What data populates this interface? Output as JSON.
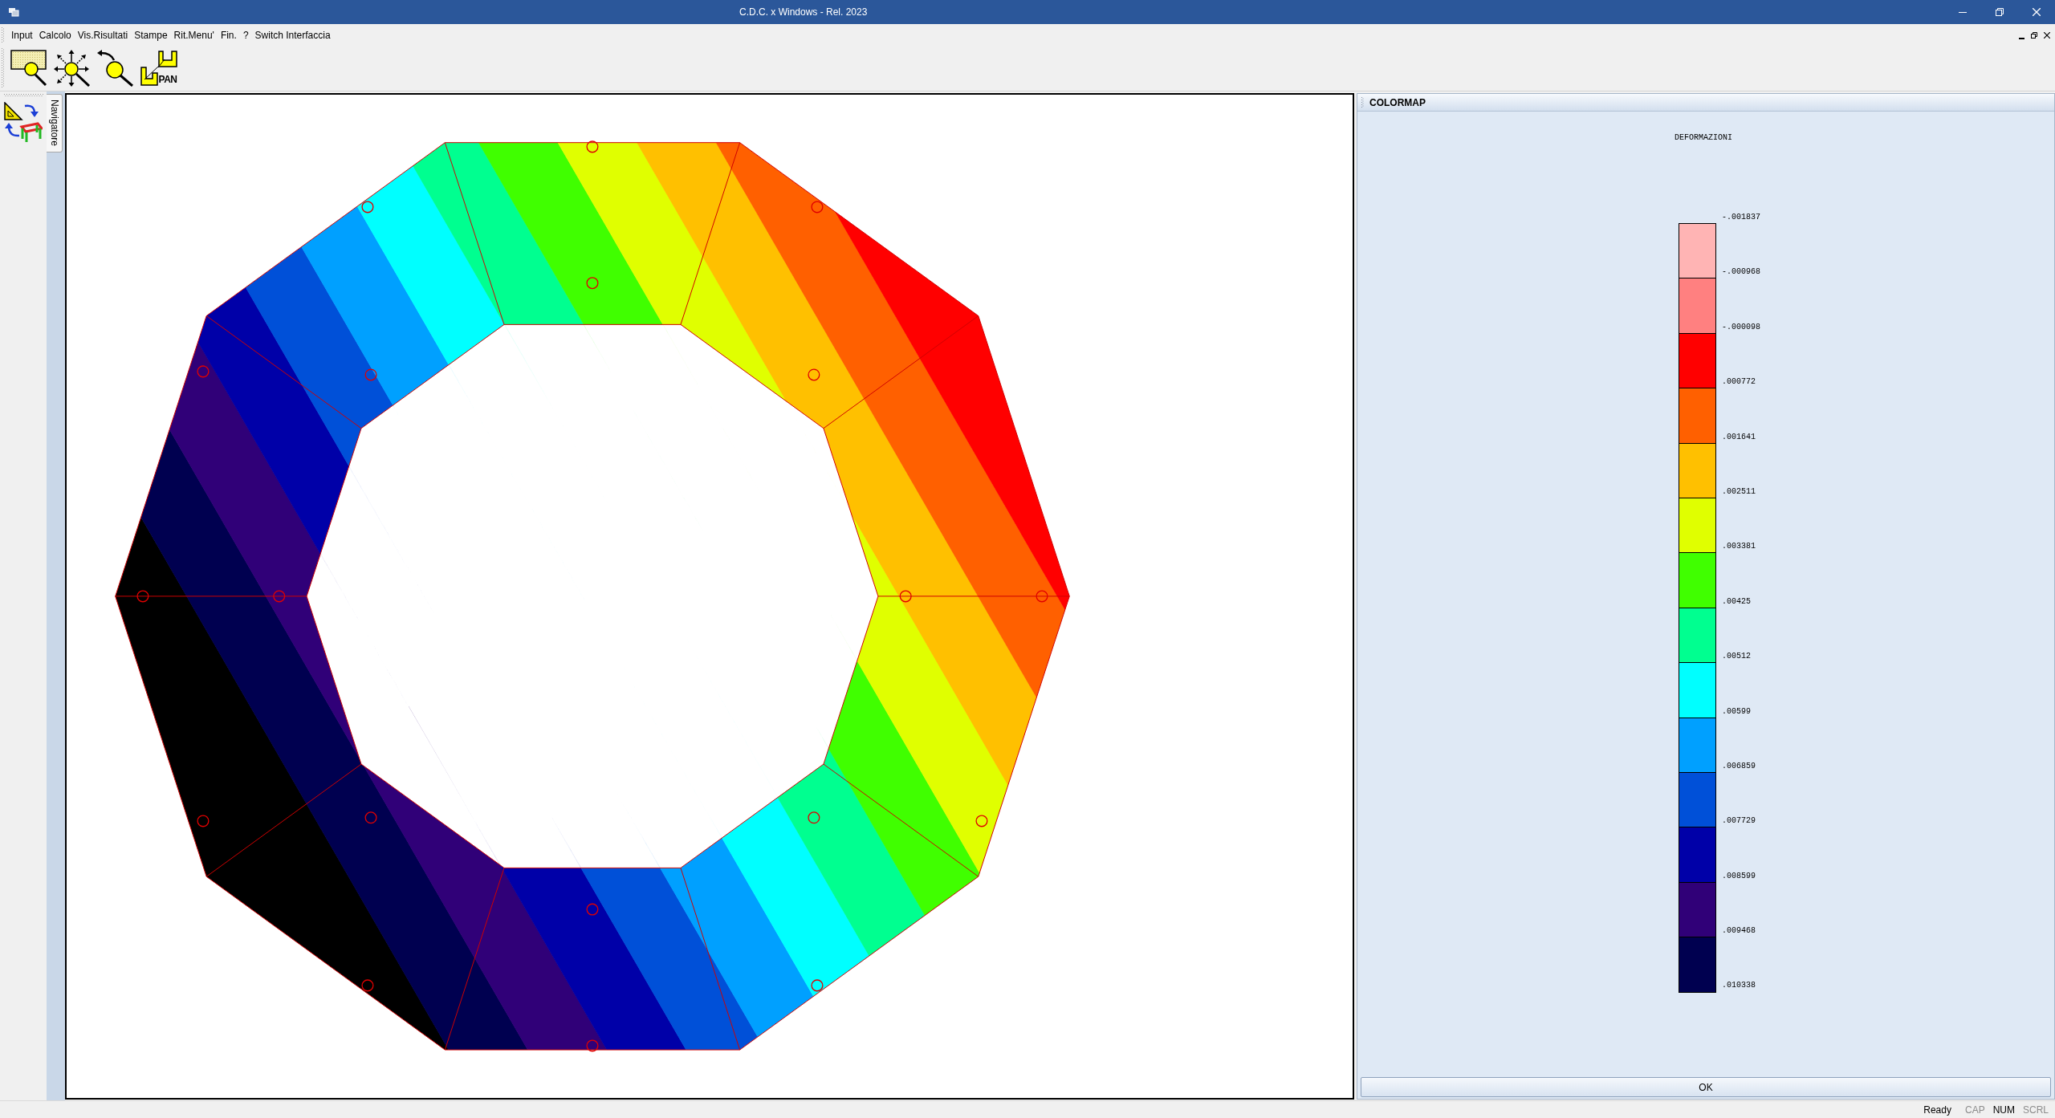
{
  "window": {
    "title": "C.D.C. x Windows - Rel. 2023"
  },
  "menu": [
    "Input",
    "Calcolo",
    "Vis.Risultati",
    "Stampe",
    "Rit.Menu'",
    "Fin.",
    "?",
    "Switch Interfaccia"
  ],
  "toolbar": [
    {
      "kind": "window"
    },
    {
      "kind": "extents"
    },
    {
      "kind": "previous"
    },
    {
      "kind": "pan",
      "label": "PAN"
    }
  ],
  "navigator": {
    "tab": "Navigatore"
  },
  "colormap": {
    "title": "COLORMAP",
    "heading": "DEFORMAZIONI",
    "bins": [
      {
        "color": "#ffb4b4"
      },
      {
        "color": "#ff8080"
      },
      {
        "color": "#ff0000"
      },
      {
        "color": "#ff6000"
      },
      {
        "color": "#ffc000"
      },
      {
        "color": "#e0ff00"
      },
      {
        "color": "#40ff00"
      },
      {
        "color": "#00ff90"
      },
      {
        "color": "#00ffff"
      },
      {
        "color": "#00a0ff"
      },
      {
        "color": "#0050d8"
      },
      {
        "color": "#0000a8"
      },
      {
        "color": "#300078"
      },
      {
        "color": "#000050"
      }
    ],
    "labels": [
      "-.001837",
      "-.000968",
      "-.000098",
      ".000772",
      ".001641",
      ".002511",
      ".003381",
      ".00425",
      ".00512",
      ".00599",
      ".006859",
      ".007729",
      ".008599",
      ".009468",
      ".010338"
    ],
    "button": "OK"
  },
  "status_bar": {
    "message": "Ready",
    "indicators": [
      {
        "label": "CAP",
        "on": false
      },
      {
        "label": "NUM",
        "on": true
      },
      {
        "label": "SCRL",
        "on": false
      }
    ]
  }
}
